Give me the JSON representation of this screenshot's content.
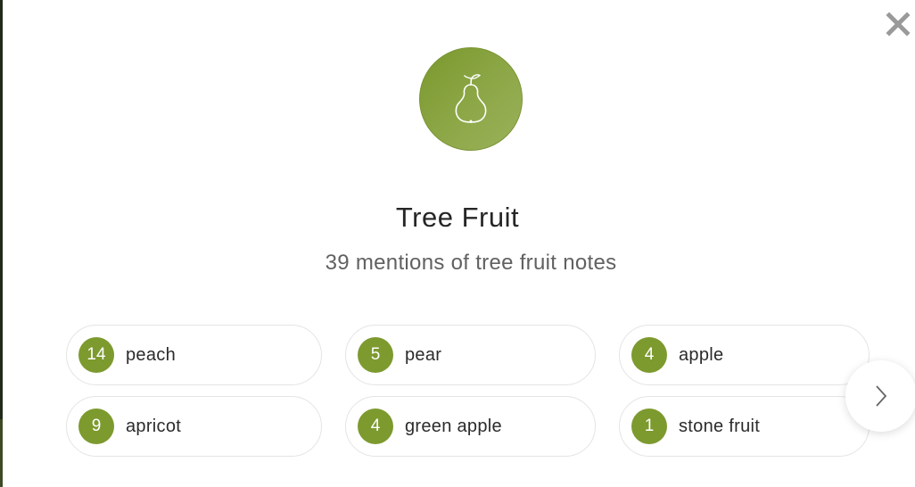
{
  "modal": {
    "title": "Tree Fruit",
    "subtitle": "39 mentions of tree fruit notes",
    "icon": "pear-icon",
    "close_icon": "close-icon",
    "next_icon": "chevron-right-icon",
    "accent_color": "#7d9a2f"
  },
  "notes": [
    {
      "count": "14",
      "label": "peach"
    },
    {
      "count": "5",
      "label": "pear"
    },
    {
      "count": "4",
      "label": "apple"
    },
    {
      "count": "9",
      "label": "apricot"
    },
    {
      "count": "4",
      "label": "green apple"
    },
    {
      "count": "1",
      "label": "stone fruit"
    }
  ]
}
